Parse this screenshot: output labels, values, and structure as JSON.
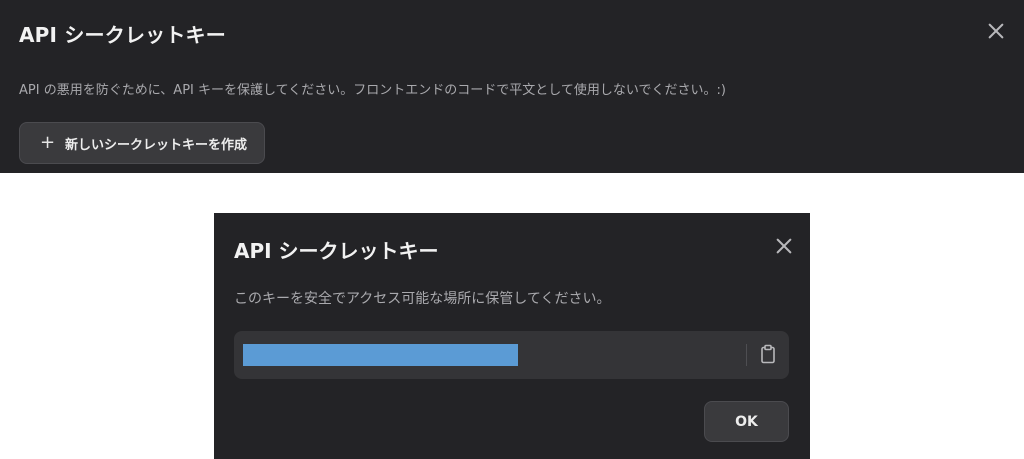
{
  "settings_panel": {
    "title": "API シークレットキー",
    "description": "API の悪用を防ぐために、API キーを保護してください。フロントエンドのコードで平文として使用しないでください。:)",
    "create_button": {
      "icon": "plus-icon",
      "label": "新しいシークレットキーを作成"
    },
    "close_icon": "close-icon"
  },
  "modal": {
    "title": "API シークレットキー",
    "description": "このキーを安全でアクセス可能な場所に保管してください。",
    "secret_key": {
      "redacted": true,
      "copy_icon": "clipboard-icon"
    },
    "ok_button": "OK",
    "close_icon": "close-icon"
  },
  "colors": {
    "panel_bg": "#232326",
    "field_bg": "#343437",
    "button_bg": "#3a3a3d",
    "redaction": "#5b9bd5",
    "muted_text": "#a9a9ad"
  }
}
